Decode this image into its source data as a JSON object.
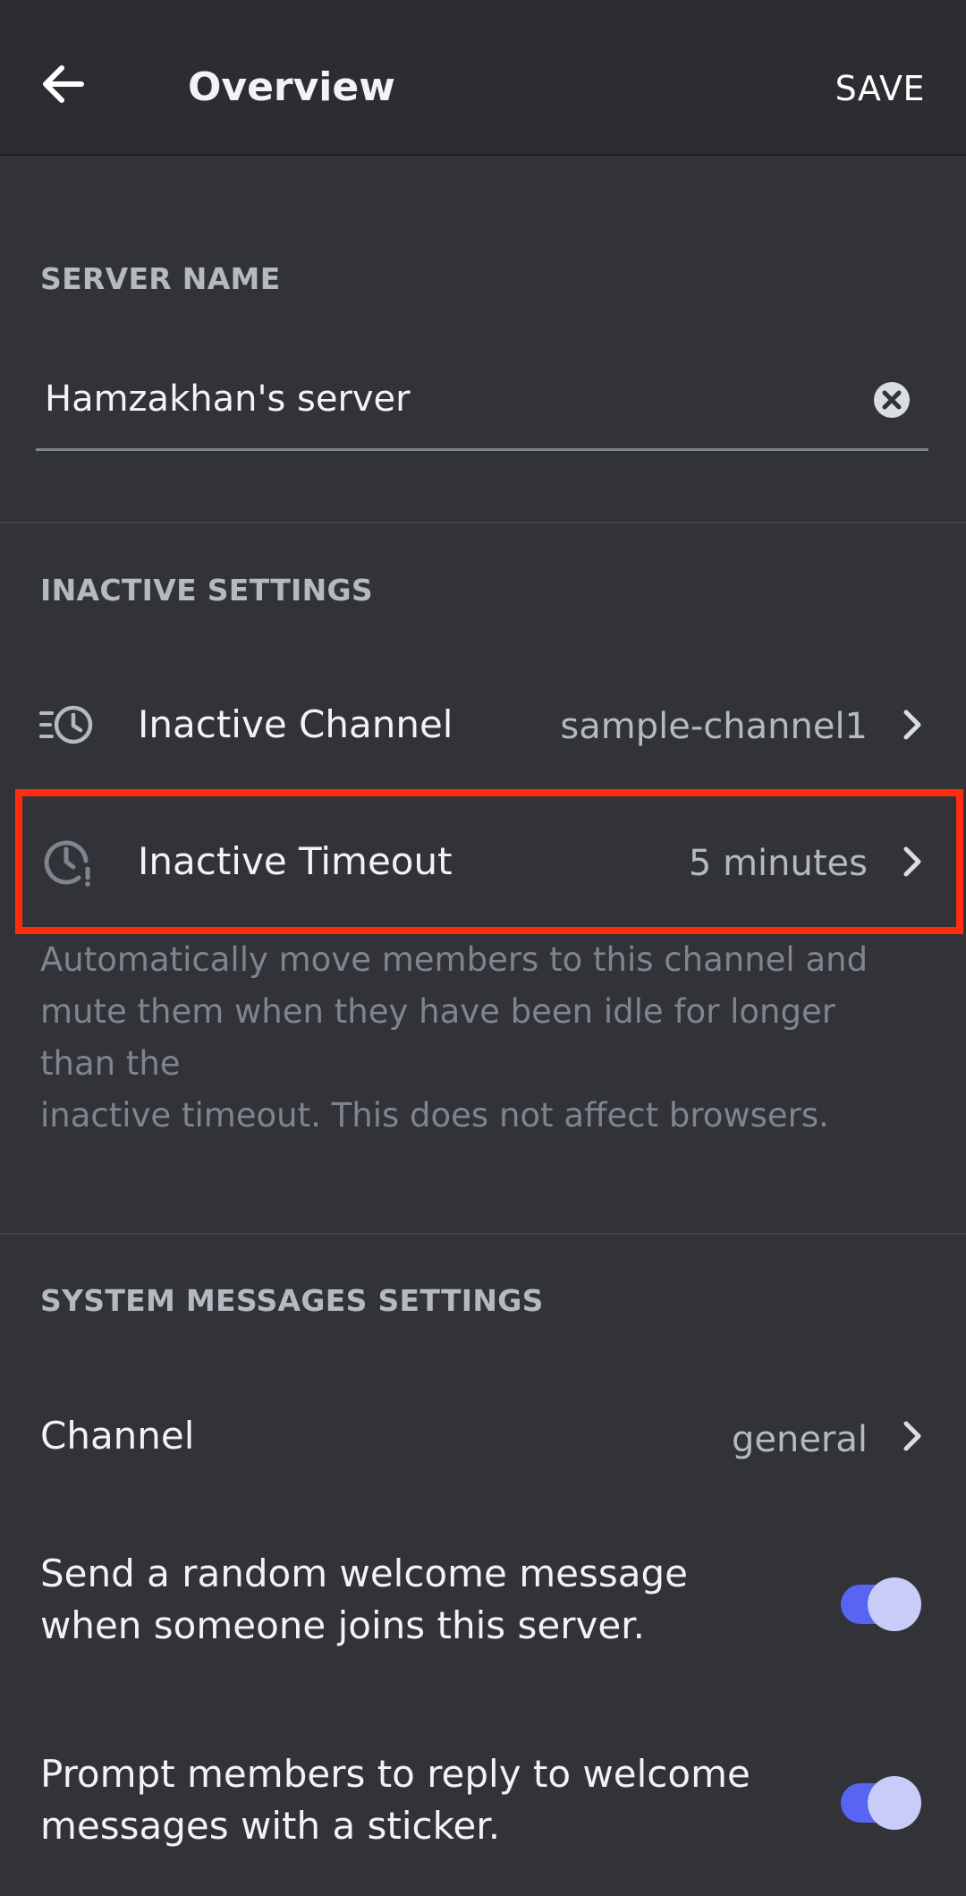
{
  "header": {
    "title": "Overview",
    "save_label": "SAVE"
  },
  "server_name": {
    "section_label": "SERVER NAME",
    "value": "Hamzakhan's server"
  },
  "inactive": {
    "section_label": "INACTIVE SETTINGS",
    "channel_label": "Inactive Channel",
    "channel_value": "sample-channel1",
    "timeout_label": "Inactive Timeout",
    "timeout_value": "5 minutes",
    "help_lines": [
      "Automatically move members to this channel and",
      "mute them when they have been idle for longer",
      "than the",
      "inactive timeout. This does not affect browsers."
    ]
  },
  "system_messages": {
    "section_label": "SYSTEM MESSAGES SETTINGS",
    "channel_label": "Channel",
    "channel_value": "general",
    "welcome_lines": [
      "Send a random welcome message",
      "when someone joins this server."
    ],
    "welcome_enabled": true,
    "sticker_lines": [
      "Prompt members to reply to welcome",
      "messages with a sticker."
    ],
    "sticker_enabled": true
  },
  "colors": {
    "background": "#313338",
    "header_background": "#2b2d31",
    "toggle_on": "#5865f2",
    "highlight": "#ff2d10"
  },
  "icons": {
    "back": "arrow-left-icon",
    "clear": "clear-circle-x-icon",
    "inactive_channel": "list-clock-icon",
    "inactive_timeout": "clock-alert-icon",
    "chevron": "chevron-right-icon"
  }
}
